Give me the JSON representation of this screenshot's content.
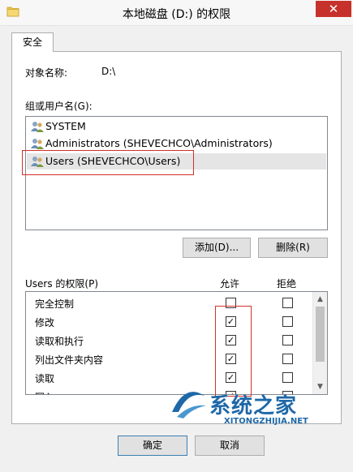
{
  "window": {
    "title": "本地磁盘 (D:) 的权限",
    "close_glyph": "✕"
  },
  "tabs": [
    {
      "label": "安全"
    }
  ],
  "object": {
    "label": "对象名称:",
    "value": "D:\\"
  },
  "groups": {
    "label": "组或用户名(G):",
    "items": [
      {
        "label": "SYSTEM",
        "icon": "users-group-icon"
      },
      {
        "label": "Administrators (SHEVECHCO\\Administrators)",
        "icon": "users-group-icon"
      },
      {
        "label": "Users (SHEVECHCO\\Users)",
        "icon": "users-group-icon",
        "selected": true
      }
    ]
  },
  "buttons": {
    "add": "添加(D)...",
    "remove": "删除(R)",
    "ok": "确定",
    "cancel": "取消"
  },
  "permissions": {
    "label": "Users 的权限(P)",
    "allow_header": "允许",
    "deny_header": "拒绝",
    "rows": [
      {
        "name": "完全控制",
        "allow": false,
        "deny": false
      },
      {
        "name": "修改",
        "allow": true,
        "deny": false
      },
      {
        "name": "读取和执行",
        "allow": true,
        "deny": false
      },
      {
        "name": "列出文件夹内容",
        "allow": true,
        "deny": false
      },
      {
        "name": "读取",
        "allow": true,
        "deny": false
      },
      {
        "name": "写入",
        "allow": true,
        "deny": false
      }
    ]
  },
  "watermark": {
    "brand": "系统之家",
    "url": "XITONGZHIJIA.NET"
  },
  "colors": {
    "highlight": "#d3302a",
    "close": "#c7312b",
    "brand": "#1e68a8"
  }
}
